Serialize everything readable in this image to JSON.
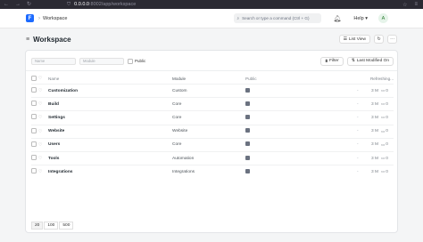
{
  "browser": {
    "back": "←",
    "forward": "→",
    "reload": "↻",
    "url_host": "0.0.0.0",
    "url_rest": ":8002/app/workspace"
  },
  "navbar": {
    "logo": "F",
    "breadcrumb": "Workspace",
    "search_placeholder": "Search or type a command (Ctrl + G)",
    "help": "Help",
    "avatar": "A"
  },
  "page": {
    "title": "Workspace",
    "list_view": "List View"
  },
  "filters": {
    "name_placeholder": "Name",
    "module_placeholder": "Module",
    "public_label": "Public",
    "filter": "Filter",
    "sort": "Last Modified On"
  },
  "table": {
    "headers": {
      "name": "Name",
      "module": "Module",
      "public": "Public",
      "refreshing": "Refreshing..."
    },
    "rows": [
      {
        "name": "Customization",
        "module": "Custom",
        "public": true,
        "dash": "-",
        "time": "3 M",
        "comments": "0"
      },
      {
        "name": "Build",
        "module": "Core",
        "public": true,
        "dash": "-",
        "time": "3 M",
        "comments": "0"
      },
      {
        "name": "Settings",
        "module": "Core",
        "public": true,
        "dash": "-",
        "time": "3 M",
        "comments": "0"
      },
      {
        "name": "Website",
        "module": "Website",
        "public": true,
        "dash": "-",
        "time": "3 M",
        "comments": "0"
      },
      {
        "name": "Users",
        "module": "Core",
        "public": true,
        "dash": "-",
        "time": "3 M",
        "comments": "0"
      },
      {
        "name": "Tools",
        "module": "Automation",
        "public": true,
        "dash": "-",
        "time": "3 M",
        "comments": "0"
      },
      {
        "name": "Integrations",
        "module": "Integrations",
        "public": true,
        "dash": "-",
        "time": "3 M",
        "comments": "0"
      }
    ]
  },
  "paging": {
    "sizes": [
      "20",
      "100",
      "500"
    ]
  }
}
